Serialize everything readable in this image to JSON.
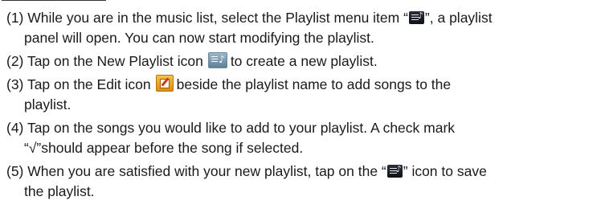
{
  "steps": [
    {
      "num": "(1)",
      "a": "While you are in the music list, select the Playlist menu item “",
      "icon": "playlist-menu-icon",
      "b": "”, a playlist",
      "line2": "panel will open. You can now start modifying the playlist."
    },
    {
      "num": "(2)",
      "a": "Tap on the New Playlist icon",
      "icon": "new-playlist-icon",
      "b": "to create a new playlist."
    },
    {
      "num": "(3)",
      "a": "Tap on the Edit icon",
      "icon": "edit-icon",
      "b": "beside the playlist name to add songs to the",
      "line2": "playlist."
    },
    {
      "num": "(4)",
      "a": "Tap on the songs you would like to add to your playlist. A check mark",
      "line2": "“√”should appear before the song if selected."
    },
    {
      "num": "(5)",
      "a": "When you are satisfied with your new playlist, tap on the “",
      "icon": "playlist-menu-icon",
      "b": "” icon to save",
      "line2": "the playlist."
    }
  ]
}
